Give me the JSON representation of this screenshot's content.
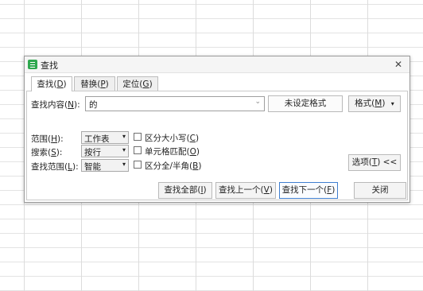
{
  "dialog": {
    "title": "查找",
    "close_glyph": "✕",
    "icon": "find-app-icon"
  },
  "tabs": [
    {
      "label": "查找(",
      "key": "D",
      "suffix": ")",
      "active": true
    },
    {
      "label": "替换(",
      "key": "P",
      "suffix": ")",
      "active": false
    },
    {
      "label": "定位(",
      "key": "G",
      "suffix": ")",
      "active": false
    }
  ],
  "find": {
    "label": "查找内容(",
    "key": "N",
    "suffix": "):",
    "value": "的",
    "caret": "⌄",
    "no_format_label": "未设定格式",
    "format_label": "格式(",
    "format_key": "M",
    "format_suffix": ")",
    "format_caret": "▾"
  },
  "options": {
    "scope": {
      "label": "范围(",
      "key": "H",
      "suffix": "):",
      "value": "工作表"
    },
    "search": {
      "label": "搜索(",
      "key": "S",
      "suffix": "):",
      "value": "按行"
    },
    "look_in": {
      "label": "查找范围(",
      "key": "L",
      "suffix": "):",
      "value": "智能"
    },
    "select_caret": "▾",
    "match_case": {
      "label": "区分大小写(",
      "key": "C",
      "suffix": ")",
      "checked": false
    },
    "match_cell": {
      "label": "单元格匹配(",
      "key": "O",
      "suffix": ")",
      "checked": false
    },
    "match_width": {
      "label": "区分全/半角(",
      "key": "B",
      "suffix": ")",
      "checked": false
    },
    "options_button": {
      "label": "选项(",
      "key": "T",
      "suffix": ") <<"
    }
  },
  "buttons": {
    "find_all": {
      "label": "查找全部(",
      "key": "I",
      "suffix": ")"
    },
    "find_prev": {
      "label": "查找上一个(",
      "key": "V",
      "suffix": ")"
    },
    "find_next": {
      "label": "查找下一个(",
      "key": "F",
      "suffix": ")"
    },
    "close": {
      "label": "关闭"
    }
  },
  "colors": {
    "app_icon": "#2fa84f",
    "default_button_border": "#3f7fd0",
    "grid_line": "#dcdcdc"
  }
}
